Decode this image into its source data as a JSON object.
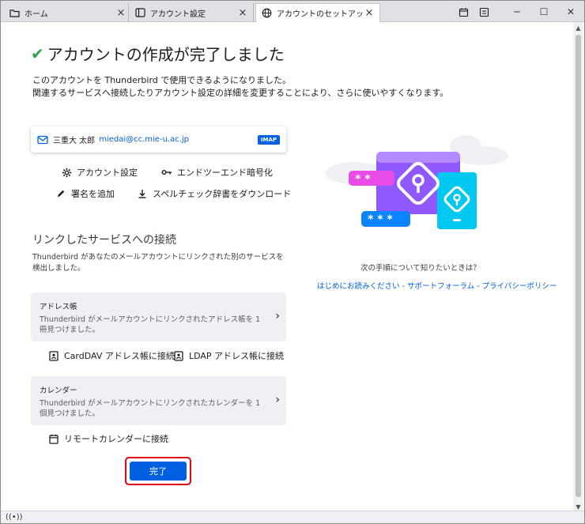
{
  "tabs": [
    {
      "label": "ホーム",
      "icon": "folder-icon"
    },
    {
      "label": "アカウント設定",
      "icon": "settings-page-icon"
    },
    {
      "label": "アカウントのセットアップ",
      "icon": "globe-icon"
    }
  ],
  "title": "アカウントの作成が完了しました",
  "intro": {
    "line1": "このアカウントを Thunderbird で使用できるようになりました。",
    "line2": "関連するサービスへ接続したりアカウント設定の詳細を変更することにより、さらに使いやすくなります。"
  },
  "account": {
    "name": "三重大 太郎",
    "email": "miedai@cc.mie-u.ac.jp",
    "badge": "IMAP"
  },
  "actions": {
    "account_settings": "アカウント設定",
    "e2e": "エンドツーエンド暗号化",
    "signature": "署名を追加",
    "spellcheck": "スペルチェック辞書をダウンロード"
  },
  "linked": {
    "title": "リンクしたサービスへの接続",
    "desc": "Thunderbird があなたのメールアカウントにリンクされた別のサービスを検出しました。"
  },
  "addressbook": {
    "title": "アドレス帳",
    "desc": "Thunderbird がメールアカウントにリンクされたアドレス帳を 1 冊見つけました。",
    "carddav": "CardDAV アドレス帳に接続",
    "ldap": "LDAP アドレス帳に接続"
  },
  "calendar": {
    "title": "カレンダー",
    "desc": "Thunderbird がメールアカウントにリンクされたカレンダーを 1 個見つけました。",
    "remote": "リモートカレンダーに接続"
  },
  "finish_label": "完了",
  "help": {
    "question": "次の手順について知りたいときは？",
    "links": [
      "はじめにお読みください",
      "サポートフォーラム",
      "プライバシーポリシー"
    ],
    "separator": "-"
  },
  "colors": {
    "accent": "#0061e0",
    "success": "#2ea44f",
    "highlight": "#e0001c"
  }
}
